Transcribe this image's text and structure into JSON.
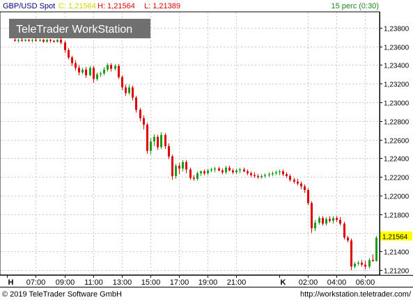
{
  "header": {
    "symbol": "GBP/USD Spot",
    "close_label": "C: 1,21564",
    "high_label": "H: 1,21564",
    "low_label": "L: 1,21389",
    "interval": "15 perc (0:30)"
  },
  "watermark": "TeleTrader WorkStation",
  "footer": {
    "copyright": "© 2019 TeleTrader Software GmbH",
    "url": "http://workstation.teletrader.com/"
  },
  "colors": {
    "up": "#1a9e1a",
    "down": "#e00000",
    "grid": "#c8c8c8",
    "last_price_bg": "#ffff00",
    "close_label": "#d4d400",
    "high_label": "#e00000",
    "low_label": "#e00000",
    "interval_label": "#1a8a1a"
  },
  "chart_data": {
    "type": "candlestick",
    "interval": "15 perc",
    "ylim": [
      1.2115,
      1.2397
    ],
    "y_ticks": [
      "1,23800",
      "1,23600",
      "1,23400",
      "1,23200",
      "1,23000",
      "1,22800",
      "1,22600",
      "1,22400",
      "1,22200",
      "1,22000",
      "1,21800",
      "1,21600",
      "1,21400",
      "1,21200"
    ],
    "y_tick_values": [
      1.238,
      1.236,
      1.234,
      1.232,
      1.23,
      1.228,
      1.226,
      1.224,
      1.222,
      1.22,
      1.218,
      1.216,
      1.214,
      1.212
    ],
    "x_ticks": [
      "H",
      "07:00",
      "09:00",
      "11:00",
      "13:00",
      "15:00",
      "17:00",
      "19:00",
      "21:00",
      "K",
      "02:00",
      "04:00",
      "06:00"
    ],
    "x_tick_hours": [
      5,
      7,
      9,
      11,
      13,
      15,
      17,
      19,
      21,
      24,
      26,
      28,
      30
    ],
    "last_price": "1,21564",
    "last_price_value": 1.21564,
    "candles": [
      {
        "t": 5.5,
        "o": 1.2367,
        "h": 1.2369,
        "l": 1.2365,
        "c": 1.2366
      },
      {
        "t": 5.75,
        "o": 1.2366,
        "h": 1.2368,
        "l": 1.2364,
        "c": 1.2367
      },
      {
        "t": 6.0,
        "o": 1.2367,
        "h": 1.2369,
        "l": 1.2365,
        "c": 1.2366
      },
      {
        "t": 6.25,
        "o": 1.2366,
        "h": 1.2368,
        "l": 1.2365,
        "c": 1.2367
      },
      {
        "t": 6.5,
        "o": 1.2367,
        "h": 1.2368,
        "l": 1.2365,
        "c": 1.2366
      },
      {
        "t": 6.75,
        "o": 1.2366,
        "h": 1.2368,
        "l": 1.2364,
        "c": 1.2367
      },
      {
        "t": 7.0,
        "o": 1.2367,
        "h": 1.2369,
        "l": 1.2365,
        "c": 1.2366
      },
      {
        "t": 7.25,
        "o": 1.2366,
        "h": 1.2368,
        "l": 1.2365,
        "c": 1.2367
      },
      {
        "t": 7.5,
        "o": 1.2367,
        "h": 1.2368,
        "l": 1.2364,
        "c": 1.2365
      },
      {
        "t": 7.75,
        "o": 1.2365,
        "h": 1.2368,
        "l": 1.2364,
        "c": 1.2367
      },
      {
        "t": 8.0,
        "o": 1.2367,
        "h": 1.2368,
        "l": 1.2364,
        "c": 1.2366
      },
      {
        "t": 8.25,
        "o": 1.2366,
        "h": 1.2367,
        "l": 1.2364,
        "c": 1.2365
      },
      {
        "t": 8.5,
        "o": 1.2365,
        "h": 1.2368,
        "l": 1.2364,
        "c": 1.2367
      },
      {
        "t": 8.75,
        "o": 1.2367,
        "h": 1.237,
        "l": 1.2362,
        "c": 1.2364
      },
      {
        "t": 9.0,
        "o": 1.2364,
        "h": 1.2366,
        "l": 1.2353,
        "c": 1.2356
      },
      {
        "t": 9.25,
        "o": 1.2356,
        "h": 1.2358,
        "l": 1.2346,
        "c": 1.2348
      },
      {
        "t": 9.5,
        "o": 1.2348,
        "h": 1.235,
        "l": 1.2339,
        "c": 1.2342
      },
      {
        "t": 9.75,
        "o": 1.2342,
        "h": 1.2345,
        "l": 1.2334,
        "c": 1.2337
      },
      {
        "t": 10.0,
        "o": 1.2337,
        "h": 1.234,
        "l": 1.2329,
        "c": 1.2332
      },
      {
        "t": 10.25,
        "o": 1.2332,
        "h": 1.2337,
        "l": 1.233,
        "c": 1.2335
      },
      {
        "t": 10.5,
        "o": 1.2335,
        "h": 1.2338,
        "l": 1.2326,
        "c": 1.2329
      },
      {
        "t": 10.75,
        "o": 1.2329,
        "h": 1.2339,
        "l": 1.2328,
        "c": 1.2337
      },
      {
        "t": 11.0,
        "o": 1.2337,
        "h": 1.2339,
        "l": 1.2321,
        "c": 1.2325
      },
      {
        "t": 11.25,
        "o": 1.2325,
        "h": 1.2332,
        "l": 1.2323,
        "c": 1.233
      },
      {
        "t": 11.5,
        "o": 1.233,
        "h": 1.2333,
        "l": 1.2327,
        "c": 1.2331
      },
      {
        "t": 11.75,
        "o": 1.2331,
        "h": 1.2338,
        "l": 1.2329,
        "c": 1.2335
      },
      {
        "t": 12.0,
        "o": 1.2335,
        "h": 1.2342,
        "l": 1.2333,
        "c": 1.234
      },
      {
        "t": 12.25,
        "o": 1.234,
        "h": 1.2342,
        "l": 1.2333,
        "c": 1.2336
      },
      {
        "t": 12.5,
        "o": 1.2336,
        "h": 1.2341,
        "l": 1.2334,
        "c": 1.2339
      },
      {
        "t": 12.75,
        "o": 1.2339,
        "h": 1.2341,
        "l": 1.2325,
        "c": 1.2327
      },
      {
        "t": 13.0,
        "o": 1.2327,
        "h": 1.2329,
        "l": 1.2313,
        "c": 1.2316
      },
      {
        "t": 13.25,
        "o": 1.2316,
        "h": 1.2319,
        "l": 1.2307,
        "c": 1.231
      },
      {
        "t": 13.5,
        "o": 1.231,
        "h": 1.2319,
        "l": 1.2308,
        "c": 1.2316
      },
      {
        "t": 13.75,
        "o": 1.2316,
        "h": 1.2318,
        "l": 1.2302,
        "c": 1.2305
      },
      {
        "t": 14.0,
        "o": 1.2305,
        "h": 1.2307,
        "l": 1.2289,
        "c": 1.2292
      },
      {
        "t": 14.25,
        "o": 1.2292,
        "h": 1.2294,
        "l": 1.228,
        "c": 1.2283
      },
      {
        "t": 14.5,
        "o": 1.2283,
        "h": 1.2286,
        "l": 1.2271,
        "c": 1.2276
      },
      {
        "t": 14.75,
        "o": 1.2276,
        "h": 1.2278,
        "l": 1.2245,
        "c": 1.2248
      },
      {
        "t": 15.0,
        "o": 1.2248,
        "h": 1.2262,
        "l": 1.2244,
        "c": 1.2258
      },
      {
        "t": 15.25,
        "o": 1.2258,
        "h": 1.2266,
        "l": 1.2253,
        "c": 1.2263
      },
      {
        "t": 15.5,
        "o": 1.2263,
        "h": 1.2265,
        "l": 1.2249,
        "c": 1.2252
      },
      {
        "t": 15.75,
        "o": 1.2252,
        "h": 1.2268,
        "l": 1.225,
        "c": 1.2265
      },
      {
        "t": 16.0,
        "o": 1.2265,
        "h": 1.2267,
        "l": 1.225,
        "c": 1.2253
      },
      {
        "t": 16.25,
        "o": 1.2253,
        "h": 1.2256,
        "l": 1.2239,
        "c": 1.2242
      },
      {
        "t": 16.5,
        "o": 1.2242,
        "h": 1.2244,
        "l": 1.2217,
        "c": 1.2221
      },
      {
        "t": 16.75,
        "o": 1.2221,
        "h": 1.2234,
        "l": 1.2218,
        "c": 1.2232
      },
      {
        "t": 17.0,
        "o": 1.2232,
        "h": 1.2235,
        "l": 1.2223,
        "c": 1.2229
      },
      {
        "t": 17.25,
        "o": 1.2229,
        "h": 1.2238,
        "l": 1.2226,
        "c": 1.2236
      },
      {
        "t": 17.5,
        "o": 1.2236,
        "h": 1.2238,
        "l": 1.2224,
        "c": 1.2228
      },
      {
        "t": 17.75,
        "o": 1.2228,
        "h": 1.223,
        "l": 1.2217,
        "c": 1.2219
      },
      {
        "t": 18.0,
        "o": 1.2219,
        "h": 1.2222,
        "l": 1.2216,
        "c": 1.2218
      },
      {
        "t": 18.25,
        "o": 1.2218,
        "h": 1.2226,
        "l": 1.2216,
        "c": 1.2224
      },
      {
        "t": 18.5,
        "o": 1.2224,
        "h": 1.2227,
        "l": 1.2221,
        "c": 1.2226
      },
      {
        "t": 18.75,
        "o": 1.2226,
        "h": 1.2228,
        "l": 1.2222,
        "c": 1.2224
      },
      {
        "t": 19.0,
        "o": 1.2224,
        "h": 1.2229,
        "l": 1.2222,
        "c": 1.2227
      },
      {
        "t": 19.25,
        "o": 1.2227,
        "h": 1.223,
        "l": 1.2225,
        "c": 1.2228
      },
      {
        "t": 19.5,
        "o": 1.2228,
        "h": 1.2231,
        "l": 1.2225,
        "c": 1.2229
      },
      {
        "t": 19.75,
        "o": 1.2229,
        "h": 1.2231,
        "l": 1.2226,
        "c": 1.2227
      },
      {
        "t": 20.0,
        "o": 1.2227,
        "h": 1.2229,
        "l": 1.2223,
        "c": 1.2225
      },
      {
        "t": 20.25,
        "o": 1.2225,
        "h": 1.2232,
        "l": 1.2223,
        "c": 1.223
      },
      {
        "t": 20.5,
        "o": 1.223,
        "h": 1.2232,
        "l": 1.2226,
        "c": 1.2227
      },
      {
        "t": 20.75,
        "o": 1.2227,
        "h": 1.2229,
        "l": 1.2223,
        "c": 1.2225
      },
      {
        "t": 21.0,
        "o": 1.2225,
        "h": 1.2229,
        "l": 1.2223,
        "c": 1.2227
      },
      {
        "t": 21.25,
        "o": 1.2227,
        "h": 1.223,
        "l": 1.2224,
        "c": 1.2228
      },
      {
        "t": 21.5,
        "o": 1.2228,
        "h": 1.223,
        "l": 1.2225,
        "c": 1.2226
      },
      {
        "t": 21.75,
        "o": 1.2226,
        "h": 1.2228,
        "l": 1.2222,
        "c": 1.2224
      },
      {
        "t": 22.0,
        "o": 1.2224,
        "h": 1.2226,
        "l": 1.222,
        "c": 1.2222
      },
      {
        "t": 22.25,
        "o": 1.2222,
        "h": 1.2225,
        "l": 1.2219,
        "c": 1.2221
      },
      {
        "t": 22.5,
        "o": 1.2221,
        "h": 1.2223,
        "l": 1.2218,
        "c": 1.222
      },
      {
        "t": 22.75,
        "o": 1.222,
        "h": 1.2223,
        "l": 1.2218,
        "c": 1.2221
      },
      {
        "t": 23.0,
        "o": 1.2221,
        "h": 1.2224,
        "l": 1.2219,
        "c": 1.2222
      },
      {
        "t": 23.25,
        "o": 1.2222,
        "h": 1.2225,
        "l": 1.222,
        "c": 1.2223
      },
      {
        "t": 23.5,
        "o": 1.2223,
        "h": 1.2226,
        "l": 1.2221,
        "c": 1.2224
      },
      {
        "t": 23.75,
        "o": 1.2224,
        "h": 1.2227,
        "l": 1.2222,
        "c": 1.2225
      },
      {
        "t": 24.0,
        "o": 1.2225,
        "h": 1.2228,
        "l": 1.2222,
        "c": 1.2226
      },
      {
        "t": 24.25,
        "o": 1.2226,
        "h": 1.2228,
        "l": 1.2221,
        "c": 1.2223
      },
      {
        "t": 24.5,
        "o": 1.2223,
        "h": 1.2225,
        "l": 1.2219,
        "c": 1.2221
      },
      {
        "t": 24.75,
        "o": 1.2221,
        "h": 1.2223,
        "l": 1.2215,
        "c": 1.2217
      },
      {
        "t": 25.0,
        "o": 1.2217,
        "h": 1.2219,
        "l": 1.2213,
        "c": 1.2215
      },
      {
        "t": 25.25,
        "o": 1.2215,
        "h": 1.2218,
        "l": 1.2211,
        "c": 1.2213
      },
      {
        "t": 25.5,
        "o": 1.2213,
        "h": 1.2215,
        "l": 1.2207,
        "c": 1.221
      },
      {
        "t": 25.75,
        "o": 1.221,
        "h": 1.2212,
        "l": 1.2203,
        "c": 1.2206
      },
      {
        "t": 26.0,
        "o": 1.2206,
        "h": 1.2208,
        "l": 1.219,
        "c": 1.2192
      },
      {
        "t": 26.25,
        "o": 1.2192,
        "h": 1.2194,
        "l": 1.216,
        "c": 1.2165
      },
      {
        "t": 26.5,
        "o": 1.2165,
        "h": 1.2174,
        "l": 1.2162,
        "c": 1.2171
      },
      {
        "t": 26.75,
        "o": 1.2171,
        "h": 1.2178,
        "l": 1.2169,
        "c": 1.2176
      },
      {
        "t": 27.0,
        "o": 1.2176,
        "h": 1.2178,
        "l": 1.2168,
        "c": 1.217
      },
      {
        "t": 27.25,
        "o": 1.217,
        "h": 1.2177,
        "l": 1.2168,
        "c": 1.2175
      },
      {
        "t": 27.5,
        "o": 1.2175,
        "h": 1.2178,
        "l": 1.2171,
        "c": 1.2173
      },
      {
        "t": 27.75,
        "o": 1.2173,
        "h": 1.2178,
        "l": 1.217,
        "c": 1.2176
      },
      {
        "t": 28.0,
        "o": 1.2176,
        "h": 1.2178,
        "l": 1.2172,
        "c": 1.2174
      },
      {
        "t": 28.25,
        "o": 1.2174,
        "h": 1.2177,
        "l": 1.2168,
        "c": 1.217
      },
      {
        "t": 28.5,
        "o": 1.217,
        "h": 1.2172,
        "l": 1.2153,
        "c": 1.2155
      },
      {
        "t": 28.75,
        "o": 1.2155,
        "h": 1.2157,
        "l": 1.215,
        "c": 1.2152
      },
      {
        "t": 29.0,
        "o": 1.2152,
        "h": 1.2154,
        "l": 1.212,
        "c": 1.2124
      },
      {
        "t": 29.25,
        "o": 1.2124,
        "h": 1.2129,
        "l": 1.2122,
        "c": 1.2127
      },
      {
        "t": 29.5,
        "o": 1.2127,
        "h": 1.213,
        "l": 1.2125,
        "c": 1.2128
      },
      {
        "t": 29.75,
        "o": 1.2128,
        "h": 1.2131,
        "l": 1.2124,
        "c": 1.2126
      },
      {
        "t": 30.0,
        "o": 1.2126,
        "h": 1.213,
        "l": 1.2121,
        "c": 1.2124
      },
      {
        "t": 30.25,
        "o": 1.2124,
        "h": 1.2133,
        "l": 1.2122,
        "c": 1.2131
      },
      {
        "t": 30.5,
        "o": 1.2131,
        "h": 1.2137,
        "l": 1.2129,
        "c": 1.213
      },
      {
        "t": 30.75,
        "o": 1.213,
        "h": 1.2157,
        "l": 1.2129,
        "c": 1.2155
      }
    ]
  }
}
